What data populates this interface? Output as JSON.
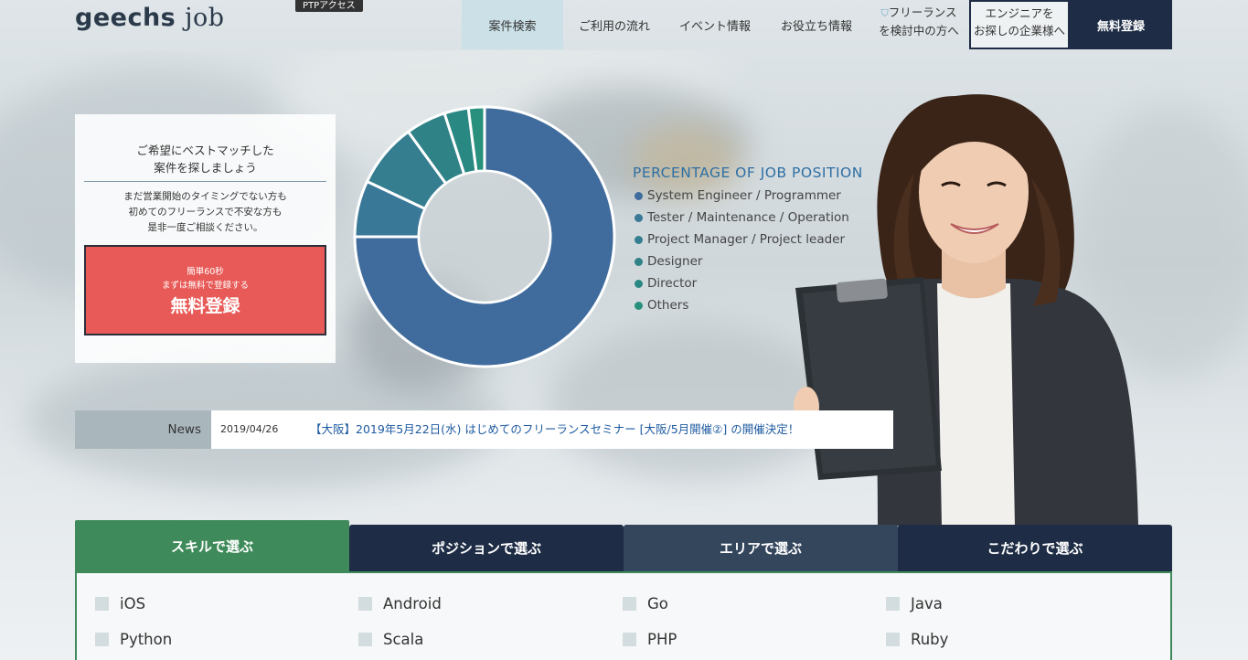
{
  "header": {
    "logo_main": "geechs",
    "logo_sub": "job",
    "tag": "PTPアクセス",
    "nav": [
      {
        "label": "案件検索"
      },
      {
        "label": "ご利用の流れ"
      },
      {
        "label": "イベント情報"
      },
      {
        "label": "お役立ち情報"
      }
    ],
    "freelance_line1": "フリーランス",
    "freelance_line2": "を検討中の方へ",
    "engineer_line1": "エンジニアを",
    "engineer_line2": "お探しの企業様へ",
    "register": "無料登録"
  },
  "card": {
    "title_line1": "ご希望にベストマッチした",
    "title_line2": "案件を探しましょう",
    "text_line1": "まだ営業開始のタイミングでない方も",
    "text_line2": "初めてのフリーランスで不安な方も",
    "text_line3": "是非一度ご相談ください。",
    "btn_small1": "簡単60秒",
    "btn_small2": "まずは無料で登録する",
    "btn_big": "無料登録"
  },
  "chart_data": {
    "type": "pie",
    "title": "PERCENTAGE OF JOB POSITION",
    "categories": [
      "System Engineer / Programmer",
      "Tester / Maintenance / Operation",
      "Project Manager / Project leader",
      "Designer",
      "Director",
      "Others"
    ],
    "values": [
      75,
      7,
      8,
      5,
      3,
      2
    ],
    "colors": [
      "#406c9d",
      "#3a7898",
      "#347e8f",
      "#2f8286",
      "#2a8882",
      "#28907d"
    ],
    "legend_position": "right"
  },
  "news": {
    "label": "News",
    "date": "2019/04/26",
    "text": "【大阪】2019年5月22日(水) はじめてのフリーランスセミナー [大阪/5月開催②] の開催決定！"
  },
  "tabs": [
    {
      "label": "スキルで選ぶ"
    },
    {
      "label": "ポジションで選ぶ"
    },
    {
      "label": "エリアで選ぶ"
    },
    {
      "label": "こだわりで選ぶ"
    }
  ],
  "skills": [
    "iOS",
    "Android",
    "Go",
    "Java",
    "Python",
    "Scala",
    "PHP",
    "Ruby"
  ]
}
